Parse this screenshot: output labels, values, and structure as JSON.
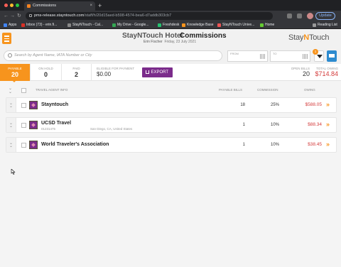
{
  "browser": {
    "tab_title": "Commissions",
    "tab_close": "×",
    "new_tab": "+",
    "url_host": "pms-release.stayntouch.com",
    "url_path": "/staff/h/20d15aed-b598-4574-bea6-d7addb303cb7",
    "update_label": "Update",
    "nav": {
      "back": "←",
      "forward": "→",
      "reload": "↻"
    },
    "bookmarks": [
      {
        "label": "Apps",
        "color": "#4285f4"
      },
      {
        "label": "Inbox (73) - erin.fi...",
        "color": "#d93025"
      },
      {
        "label": "StayNTouch - Cal...",
        "color": "#888888"
      },
      {
        "label": "My Drive - Google...",
        "color": "#34a853"
      },
      {
        "label": "Freshdesk",
        "color": "#25c16f"
      },
      {
        "label": "Knowledge Base",
        "color": "#f7941d"
      },
      {
        "label": "StayNTouch Unive...",
        "color": "#e55"
      },
      {
        "label": "Home",
        "color": "#6c3"
      }
    ],
    "reading_list": "Reading List"
  },
  "header": {
    "hotel": "StayNTouch Hotel",
    "title": "Commissions",
    "user": "Erin Fischer",
    "date": "Friday, 23 July 2021",
    "brand_a": "Stay",
    "brand_b": "N",
    "brand_c": "Touch"
  },
  "search": {
    "placeholder": "Search by Agent Name, IATA Number or City",
    "from_label": "FROM",
    "to_label": "TO",
    "filter_badge": "1"
  },
  "stats": {
    "payable_label": "PAYABLE",
    "payable": "20",
    "onhold_label": "ON HOLD",
    "onhold": "0",
    "paid_label": "PAID",
    "paid": "2",
    "eligible_label": "ELIGIBLE FOR PAYMENT",
    "eligible": "$0.00",
    "export_label": "EXPORT",
    "open_bills_label": "OPEN BILLS",
    "open_bills": "20",
    "total_owing_label": "TOTAL OWING",
    "total_owing": "$714.84"
  },
  "columns": {
    "agent": "TRAVEL AGENT INFO",
    "bills": "PAYABLE BILLS",
    "commission": "COMMISSION",
    "owing": "OWING"
  },
  "rows": [
    {
      "name": "Stayntouch",
      "iata": "",
      "location": "",
      "bills": "18",
      "commission": "25%",
      "owing": "$588.05"
    },
    {
      "name": "UCSD Travel",
      "iata": "01231475",
      "location": "San Diego, CA, United States",
      "bills": "1",
      "commission": "10%",
      "owing": "$88.34"
    },
    {
      "name": "World Traveler's Association",
      "iata": "",
      "location": "",
      "bills": "1",
      "commission": "10%",
      "owing": "$38.45"
    }
  ],
  "icons": {
    "expand": "»",
    "chevron": "⌄"
  },
  "colors": {
    "accent": "#f7941d",
    "export": "#7b2c8b",
    "owing": "#d43c3c",
    "print": "#2d8bcf"
  }
}
